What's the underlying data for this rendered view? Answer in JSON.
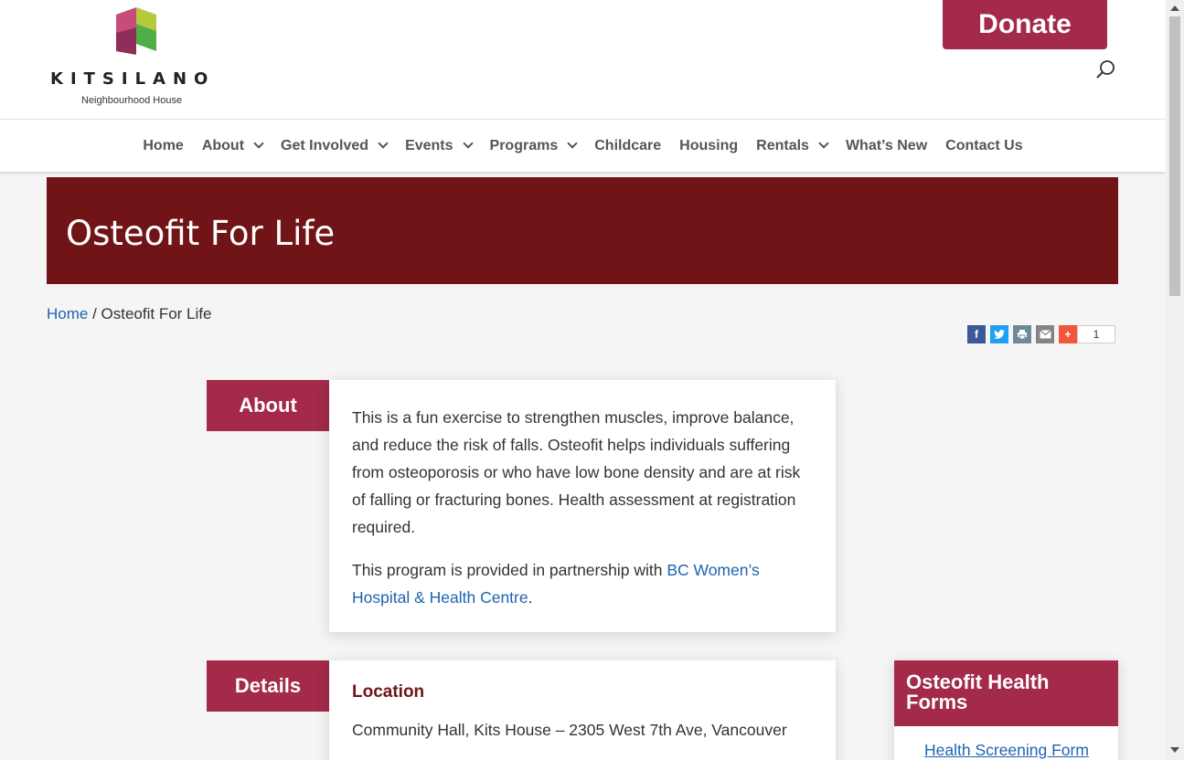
{
  "header": {
    "logo_word": "KITSILANO",
    "logo_sub": "Neighbourhood House",
    "donate_label": "Donate"
  },
  "nav": {
    "items": [
      {
        "label": "Home",
        "dropdown": false
      },
      {
        "label": "About",
        "dropdown": true
      },
      {
        "label": "Get Involved",
        "dropdown": true
      },
      {
        "label": "Events",
        "dropdown": true
      },
      {
        "label": "Programs",
        "dropdown": true
      },
      {
        "label": "Childcare",
        "dropdown": false
      },
      {
        "label": "Housing",
        "dropdown": false
      },
      {
        "label": "Rentals",
        "dropdown": true
      },
      {
        "label": "What’s New",
        "dropdown": false
      },
      {
        "label": "Contact Us",
        "dropdown": false
      }
    ]
  },
  "banner": {
    "title": "Osteofit For Life"
  },
  "breadcrumb": {
    "home": "Home",
    "separator": " / ",
    "current": "Osteofit For Life"
  },
  "share": {
    "count": "1"
  },
  "about": {
    "label": "About",
    "paragraph1": "This is a fun exercise to strengthen muscles, improve balance, and reduce the risk of falls. Osteofit helps individuals suffering from osteoporosis or who have low bone density and are at risk of falling or fracturing bones. Health assessment at registration required.",
    "paragraph2_prefix": "This program is provided in partnership with ",
    "paragraph2_link": "BC Women’s Hospital & Health Centre",
    "paragraph2_suffix": "."
  },
  "details": {
    "label": "Details",
    "location_title": "Location",
    "location_text": "Community Hall, Kits House – 2305 West 7th Ave, Vancouver"
  },
  "widget": {
    "title": "Osteofit Health Forms",
    "link": "Health Screening Form"
  },
  "colors": {
    "accent": "#a32a49",
    "banner": "#701418",
    "link": "#1e63b0"
  }
}
